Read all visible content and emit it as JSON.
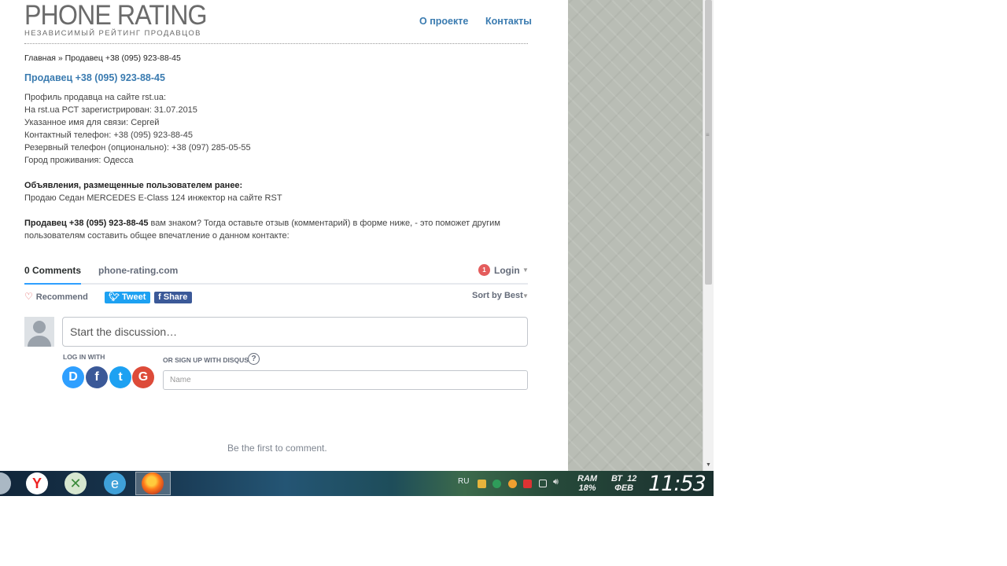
{
  "site": {
    "logo_title": "PHONE RATING",
    "logo_subtitle": "НЕЗАВИСИМЫЙ РЕЙТИНГ ПРОДАВЦОВ",
    "nav": {
      "about": "О проекте",
      "contacts": "Контакты"
    }
  },
  "breadcrumb": "Главная » Продавец +38 (095) 923-88-45",
  "page_title": "Продавец +38 (095) 923-88-45",
  "profile": {
    "lines": [
      "Профиль продавца на сайте rst.ua:",
      "На rst.ua РСТ зарегистрирован: 31.07.2015",
      "Указанное имя для связи: Сергей",
      "Контактный телефон: +38 (095) 923-88-45",
      "Резервный телефон (опционально): +38 (097) 285-05-55",
      "Город проживания: Одесса"
    ],
    "ads_heading": "Объявления, размещенные пользователем ранее:",
    "ads_item": "Продаю Седан MERCEDES E-Class 124 инжектор на сайте RST",
    "prompt_bold": "Продавец +38 (095) 923-88-45",
    "prompt_text_1": " вам знаком? Тогда оставьте отзыв (комментарий) в форме ниже, - это поможет другим",
    "prompt_text_2": "пользователям составить общее впечатление о данном контакте:"
  },
  "disqus": {
    "tab_comments": "0 Comments",
    "tab_site": "phone-rating.com",
    "login_badge": "1",
    "login_label": "Login",
    "recommend": "Recommend",
    "tweet": "Tweet",
    "share": "Share",
    "sort": "Sort by Best",
    "discussion_placeholder": "Start the discussion…",
    "log_in_with": "LOG IN WITH",
    "or_signup": "OR SIGN UP WITH DISQUS",
    "name_placeholder": "Name",
    "first_comment": "Be the first to comment.",
    "accent_color": "#2e9fff"
  },
  "taskbar": {
    "lang": "RU",
    "ram_label": "RAM",
    "ram_value": "18%",
    "day": "ВТ",
    "day_number": "12",
    "month": "ФЕВ",
    "time": "11:53"
  }
}
